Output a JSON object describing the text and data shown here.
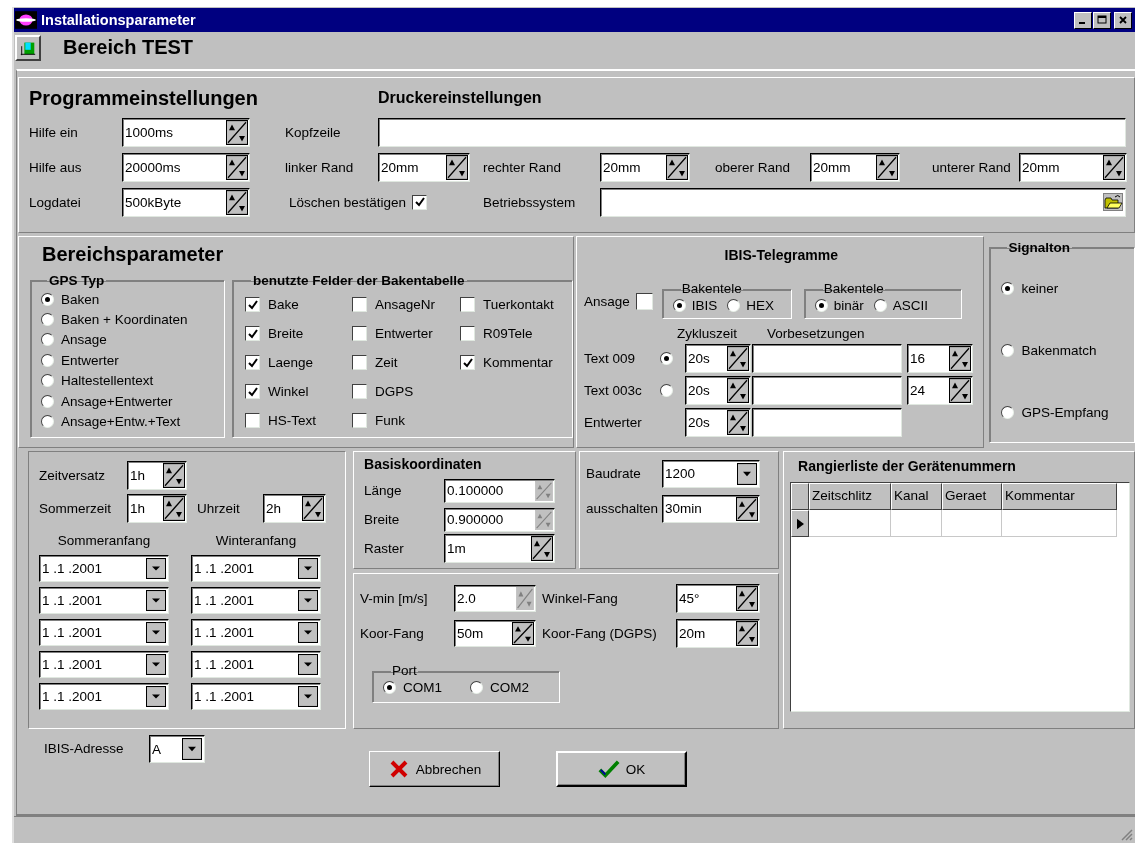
{
  "window": {
    "title": "Installationsparameter"
  },
  "header": {
    "title": "Bereich TEST"
  },
  "program_settings": {
    "title": "Programmeinstellungen",
    "fields": [
      {
        "label": "Hilfe ein",
        "value": "1000ms"
      },
      {
        "label": "Hilfe aus",
        "value": "20000ms"
      },
      {
        "label": "Logdatei",
        "value": "500kByte"
      }
    ]
  },
  "printer_settings": {
    "title": "Druckereinstellungen",
    "header_line": {
      "label": "Kopfzeile"
    },
    "margins": [
      {
        "label": "linker Rand",
        "value": "20mm"
      },
      {
        "label": "rechter Rand",
        "value": "20mm"
      },
      {
        "label": "oberer Rand",
        "value": "20mm"
      },
      {
        "label": "unterer Rand",
        "value": "20mm"
      }
    ],
    "confirm_delete": {
      "label": "Löschen bestätigen",
      "checked": true
    },
    "operating_system": {
      "label": "Betriebssystem"
    }
  },
  "area_parameters": {
    "title": "Bereichsparameter",
    "gps_type": {
      "title": "GPS Typ",
      "options": [
        {
          "label": "Baken",
          "selected": true
        },
        {
          "label": "Baken + Koordinaten",
          "selected": false
        },
        {
          "label": "Ansage",
          "selected": false
        },
        {
          "label": "Entwerter",
          "selected": false
        },
        {
          "label": "Haltestellentext",
          "selected": false
        },
        {
          "label": "Ansage+Entwerter",
          "selected": false
        },
        {
          "label": "Ansage+Entw.+Text",
          "selected": false
        }
      ]
    },
    "used_fields": {
      "title": "benutzte Felder der Bakentabelle",
      "items": [
        {
          "label": "Bake",
          "checked": true
        },
        {
          "label": "Breite",
          "checked": true
        },
        {
          "label": "Laenge",
          "checked": true
        },
        {
          "label": "Winkel",
          "checked": true
        },
        {
          "label": "HS-Text",
          "checked": false
        },
        {
          "label": "AnsageNr",
          "checked": false
        },
        {
          "label": "Entwerter",
          "checked": false
        },
        {
          "label": "Zeit",
          "checked": false
        },
        {
          "label": "DGPS",
          "checked": false
        },
        {
          "label": "Funk",
          "checked": false
        },
        {
          "label": "Tuerkontakt",
          "checked": false
        },
        {
          "label": "R09Tele",
          "checked": false
        },
        {
          "label": "Kommentar",
          "checked": true
        }
      ]
    }
  },
  "ibis_telegrams": {
    "title": "IBIS-Telegramme",
    "announcement": {
      "label": "Ansage",
      "checked": false
    },
    "groups": [
      {
        "title": "Bakentele",
        "options": [
          {
            "label": "IBIS",
            "selected": true
          },
          {
            "label": "HEX",
            "selected": false
          }
        ]
      },
      {
        "title": "Bakentele",
        "options": [
          {
            "label": "binär",
            "selected": true
          },
          {
            "label": "ASCII",
            "selected": false
          }
        ]
      }
    ],
    "column_labels": [
      "Zykluszeit",
      "Vorbesetzungen"
    ],
    "rows": [
      {
        "label": "Text 009",
        "kind": "radio",
        "selected": true,
        "cycle": "20s",
        "count": "16"
      },
      {
        "label": "Text 003c",
        "kind": "radio",
        "selected": false,
        "cycle": "20s",
        "count": "24"
      },
      {
        "label": "Entwerter",
        "kind": "plain",
        "cycle": "20s"
      }
    ]
  },
  "signal_tone": {
    "title": "Signalton",
    "options": [
      {
        "label": "keiner",
        "selected": true
      },
      {
        "label": "Bakenmatch",
        "selected": false
      },
      {
        "label": "GPS-Empfang",
        "selected": false
      }
    ]
  },
  "time": {
    "offset": {
      "label": "Zeitversatz",
      "value": "1h"
    },
    "summer_time": {
      "label": "Sommerzeit",
      "value": "1h"
    },
    "clock": {
      "label": "Uhrzeit",
      "value": "2h"
    },
    "columns": [
      {
        "title": "Sommeranfang",
        "dates": [
          "1 .1 .2001",
          "1 .1 .2001",
          "1 .1 .2001",
          "1 .1 .2001",
          "1 .1 .2001"
        ]
      },
      {
        "title": "Winteranfang",
        "dates": [
          "1 .1 .2001",
          "1 .1 .2001",
          "1 .1 .2001",
          "1 .1 .2001",
          "1 .1 .2001"
        ]
      }
    ]
  },
  "ibis_address": {
    "label": "IBIS-Adresse",
    "value": "A"
  },
  "base_coordinates": {
    "title": "Basiskoordinaten",
    "fields": [
      {
        "label": "Länge",
        "value": "0.100000",
        "disabled": true
      },
      {
        "label": "Breite",
        "value": "0.900000",
        "disabled": true
      },
      {
        "label": "Raster",
        "value": "1m",
        "disabled": false
      }
    ]
  },
  "serial": {
    "baud_rate": {
      "label": "Baudrate",
      "value": "1200"
    },
    "switch_off": {
      "label": "ausschalten",
      "value": "30min"
    }
  },
  "capture": {
    "fields": [
      {
        "label": "V-min [m/s]",
        "value": "2.0",
        "disabled": true
      },
      {
        "label": "Winkel-Fang",
        "value": "45°",
        "disabled": false
      },
      {
        "label": "Koor-Fang",
        "value": "50m",
        "disabled": false
      },
      {
        "label": "Koor-Fang (DGPS)",
        "value": "20m",
        "disabled": false
      }
    ],
    "port": {
      "title": "Port",
      "options": [
        {
          "label": "COM1",
          "selected": true
        },
        {
          "label": "COM2",
          "selected": false
        }
      ]
    }
  },
  "ranking_list": {
    "title": "Rangierliste der Gerätenummern",
    "columns": [
      "Zeitschlitz",
      "Kanal",
      "Geraet",
      "Kommentar"
    ]
  },
  "buttons": [
    {
      "label": "Abbrechen",
      "kind": "cancel"
    },
    {
      "label": "OK",
      "kind": "ok"
    }
  ]
}
